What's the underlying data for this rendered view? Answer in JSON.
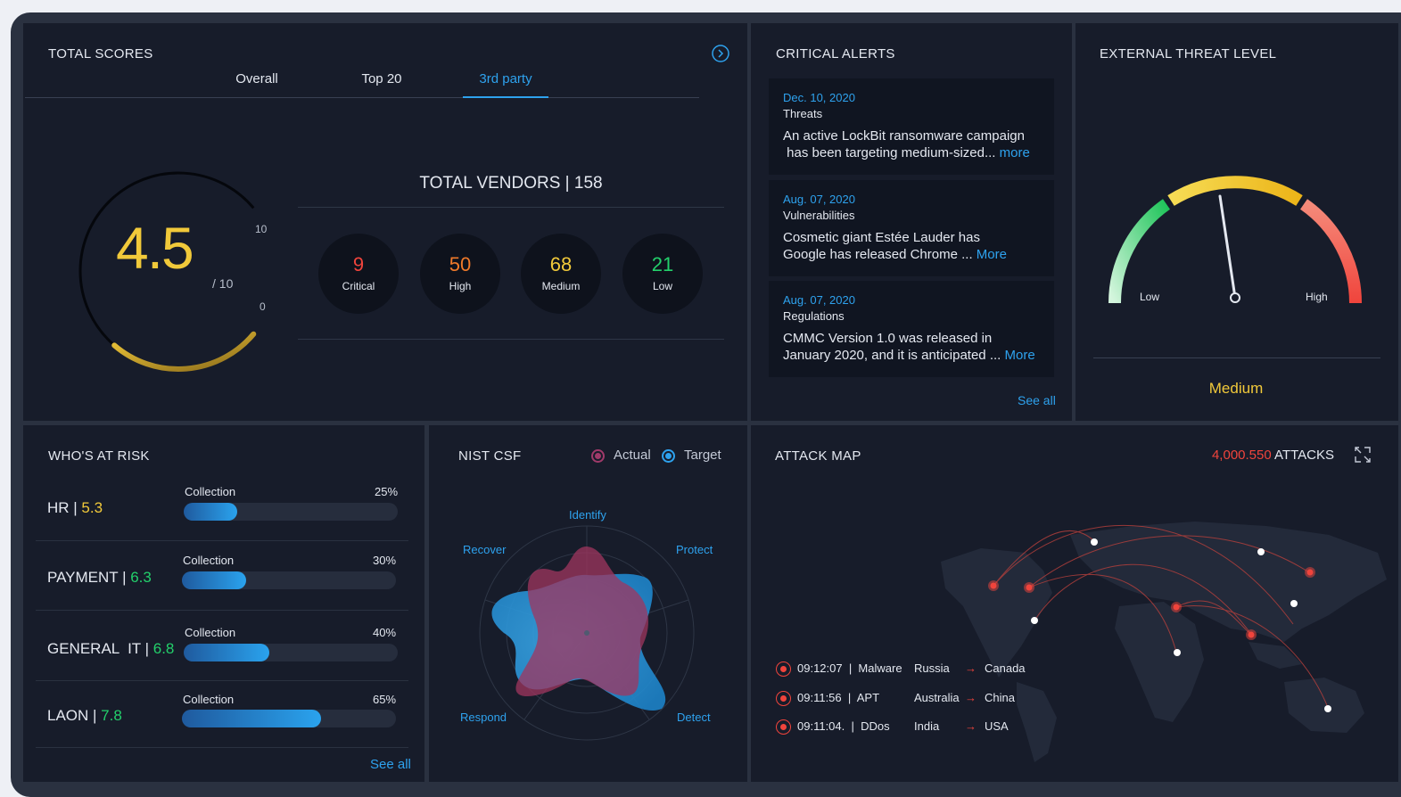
{
  "total_scores": {
    "title": "TOTAL SCORES",
    "tabs": [
      {
        "label": "Overall",
        "active": false
      },
      {
        "label": "Top 20",
        "active": false
      },
      {
        "label": "3rd party",
        "active": true
      }
    ],
    "score": "4.5",
    "score_max": "/ 10",
    "gauge_max": "10",
    "gauge_min": "0",
    "score_fraction": 0.45,
    "vendors_title": "TOTAL VENDORS | 158",
    "vendors": [
      {
        "count": "9",
        "label": "Critical",
        "color": "#f0443c"
      },
      {
        "count": "50",
        "label": "High",
        "color": "#f07a2a"
      },
      {
        "count": "68",
        "label": "Medium",
        "color": "#f1c93a"
      },
      {
        "count": "21",
        "label": "Low",
        "color": "#23d06b"
      }
    ]
  },
  "critical_alerts": {
    "title": "CRITICAL ALERTS",
    "items": [
      {
        "date": "Dec. 10, 2020",
        "category": "Threats",
        "line1": "An active LockBit ransomware campaign",
        "line2": " has been targeting medium-sized...",
        "more": "more"
      },
      {
        "date": "Aug. 07, 2020",
        "category": "Vulnerabilities",
        "line1": "Cosmetic giant Estée Lauder has",
        "line2": "Google has released Chrome ...",
        "more": "More"
      },
      {
        "date": "Aug. 07, 2020",
        "category": "Regulations",
        "line1": "CMMC Version 1.0 was released in",
        "line2": "January 2020, and it is anticipated ...",
        "more": "More"
      }
    ],
    "see_all": "See all"
  },
  "external_threat": {
    "title": "EXTERNAL THREAT LEVEL",
    "low_label": "Low",
    "high_label": "High",
    "level": "Medium"
  },
  "whos_at_risk": {
    "title": "WHO'S AT RISK",
    "rows": [
      {
        "name": "HR | ",
        "score": "5.3",
        "score_color": "#f1c93a",
        "collection": "Collection",
        "pct": "25%",
        "fraction": 0.25
      },
      {
        "name": "PAYMENT | ",
        "score": "6.3",
        "score_color": "#23d06b",
        "collection": "Collection",
        "pct": "30%",
        "fraction": 0.3
      },
      {
        "name": "GENERAL  IT | ",
        "score": "6.8",
        "score_color": "#23d06b",
        "collection": "Collection",
        "pct": "40%",
        "fraction": 0.4
      },
      {
        "name": "LAON | ",
        "score": "7.8",
        "score_color": "#23d06b",
        "collection": "Collection",
        "pct": "65%",
        "fraction": 0.65
      }
    ],
    "see_all": "See all"
  },
  "nist": {
    "title": "NIST CSF",
    "legend_actual": "Actual",
    "legend_target": "Target",
    "axes": [
      "Identify",
      "Protect",
      "Detect",
      "Respond",
      "Recover"
    ]
  },
  "attack_map": {
    "title": "ATTACK MAP",
    "count": "4,000.550",
    "count_label": " ATTACKS",
    "feed": [
      {
        "time": "09:12:07  |  Malware",
        "from": "Russia",
        "arrow": "→",
        "to": "Canada"
      },
      {
        "time": "09:11:56  |  APT",
        "from": "Australia",
        "arrow": "→",
        "to": "China"
      },
      {
        "time": "09:11:04.  |  DDos",
        "from": "India",
        "arrow": "→",
        "to": "USA"
      }
    ]
  }
}
